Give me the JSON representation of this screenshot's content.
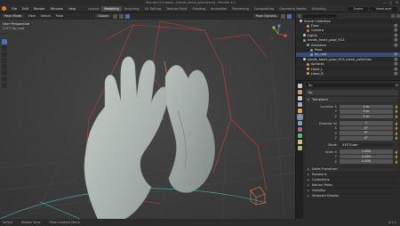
{
  "titlebar": {
    "title": "Blender [C:\\Users\\...\\hands_heart_pose.blend] - Blender 4.1",
    "controls": [
      "—",
      "▢",
      "✕"
    ]
  },
  "menubar": {
    "menus": [
      "File",
      "Edit",
      "Render",
      "Window",
      "Help"
    ],
    "workspaces": [
      "Layout",
      "Modeling",
      "Sculpting",
      "UV Editing",
      "Texture Paint",
      "Shading",
      "Animation",
      "Rendering",
      "Compositing",
      "Geometry Nodes",
      "Scripting"
    ],
    "active_workspace": "Modeling",
    "scene": "Scene",
    "view_layer": "ViewLayer"
  },
  "viewport": {
    "mode": "Pose Mode",
    "menus": [
      "View",
      "Select",
      "Pose"
    ],
    "orientation": "Global",
    "options": "Pose Options",
    "info_line1": "User Perspective",
    "info_line2": "(237) hp_root"
  },
  "outliner": {
    "rows": [
      {
        "name": "Scene Collection",
        "color": "#c8c8c8",
        "indent": 1,
        "vis": ""
      },
      {
        "name": "Floor",
        "color": "#e6a03c",
        "indent": 3,
        "vis": "👁"
      },
      {
        "name": "Camera",
        "color": "#cf7d4f",
        "indent": 3,
        "vis": "👁"
      },
      {
        "name": "Lights",
        "color": "#cbcbcb",
        "indent": 2,
        "vis": "👁"
      },
      {
        "name": "hands_heart_pose_R13",
        "color": "#7fb24c",
        "indent": 2,
        "vis": "👁"
      },
      {
        "name": "Armature",
        "color": "#67a2c5",
        "indent": 3,
        "vis": "👁"
      },
      {
        "name": "Pose",
        "color": "#67a2c5",
        "indent": 4,
        "vis": ""
      },
      {
        "name": "hp_root",
        "color": "#67a2c5",
        "indent": 4,
        "vis": "👁",
        "selected": true
      },
      {
        "name": "hands_heart_pose_R13_mesh_collection",
        "color": "#cbcbcb",
        "indent": 2,
        "vis": "👁"
      },
      {
        "name": "Spheres",
        "color": "#e6a03c",
        "indent": 3,
        "vis": "👁"
      },
      {
        "name": "Hand_L",
        "color": "#e6a03c",
        "indent": 3,
        "vis": "👁"
      },
      {
        "name": "Hand_R",
        "color": "#e6a03c",
        "indent": 3,
        "vis": "👁"
      }
    ]
  },
  "properties": {
    "object_name": "hp",
    "bone_name": "hp",
    "tabs": [
      {
        "color": "#c8c8c8"
      },
      {
        "color": "#d99a5f"
      },
      {
        "color": "#c8c8c8"
      },
      {
        "color": "#8fb1d8"
      },
      {
        "color": "#e9a24c"
      },
      {
        "color": "#5c9ad4"
      },
      {
        "color": "#7aa1c9"
      },
      {
        "color": "#c65b8e"
      },
      {
        "color": "#5fb56b"
      },
      {
        "color": "#e2c16a"
      },
      {
        "color": "#9fc26a"
      }
    ],
    "transform": {
      "title": "Transform",
      "location_label": "Location X",
      "location": [
        "0 m",
        "0 m",
        "0 m"
      ],
      "rotation_label": "Rotation W",
      "rotation": [
        "1",
        "0°",
        "0°",
        "0°"
      ],
      "mode_label": "Mode",
      "mode_value": "XYZ Euler",
      "scale_label": "Scale X",
      "scale": [
        "1.000",
        "1.000",
        "1.000"
      ],
      "axis_y": "Y",
      "axis_z": "Z",
      "axis_x": "X"
    },
    "sections": [
      "Delta Transform",
      "Relations",
      "Collections",
      "Motion Paths",
      "Visibility",
      "Viewport Display"
    ]
  },
  "statusbar": {
    "items": [
      "Select",
      "Rotate View",
      "Pose Context Menu"
    ],
    "version": "4.1.1"
  }
}
